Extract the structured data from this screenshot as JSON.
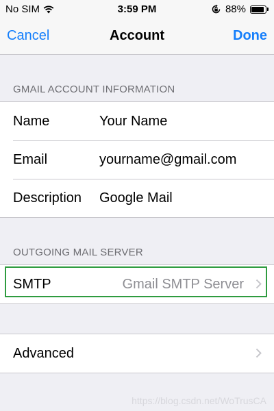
{
  "status_bar": {
    "carrier": "No SIM",
    "time": "3:59 PM",
    "battery_percent": "88%",
    "battery_level": 0.88,
    "icons": [
      "wifi-icon",
      "orientation-lock-icon",
      "battery-icon"
    ]
  },
  "nav": {
    "cancel_label": "Cancel",
    "title": "Account",
    "done_label": "Done"
  },
  "account_section": {
    "header": "GMAIL ACCOUNT INFORMATION",
    "rows": [
      {
        "label": "Name",
        "value": "Your Name"
      },
      {
        "label": "Email",
        "value": "yourname@gmail.com"
      },
      {
        "label": "Description",
        "value": "Google Mail"
      }
    ]
  },
  "outgoing_section": {
    "header": "OUTGOING MAIL SERVER",
    "smtp_label": "SMTP",
    "smtp_value": "Gmail SMTP Server"
  },
  "advanced": {
    "label": "Advanced"
  },
  "watermark": "https://blog.csdn.net/WoTrusCA",
  "colors": {
    "accent": "#147efb",
    "background": "#efeff4",
    "highlight": "#2e9b3f"
  }
}
